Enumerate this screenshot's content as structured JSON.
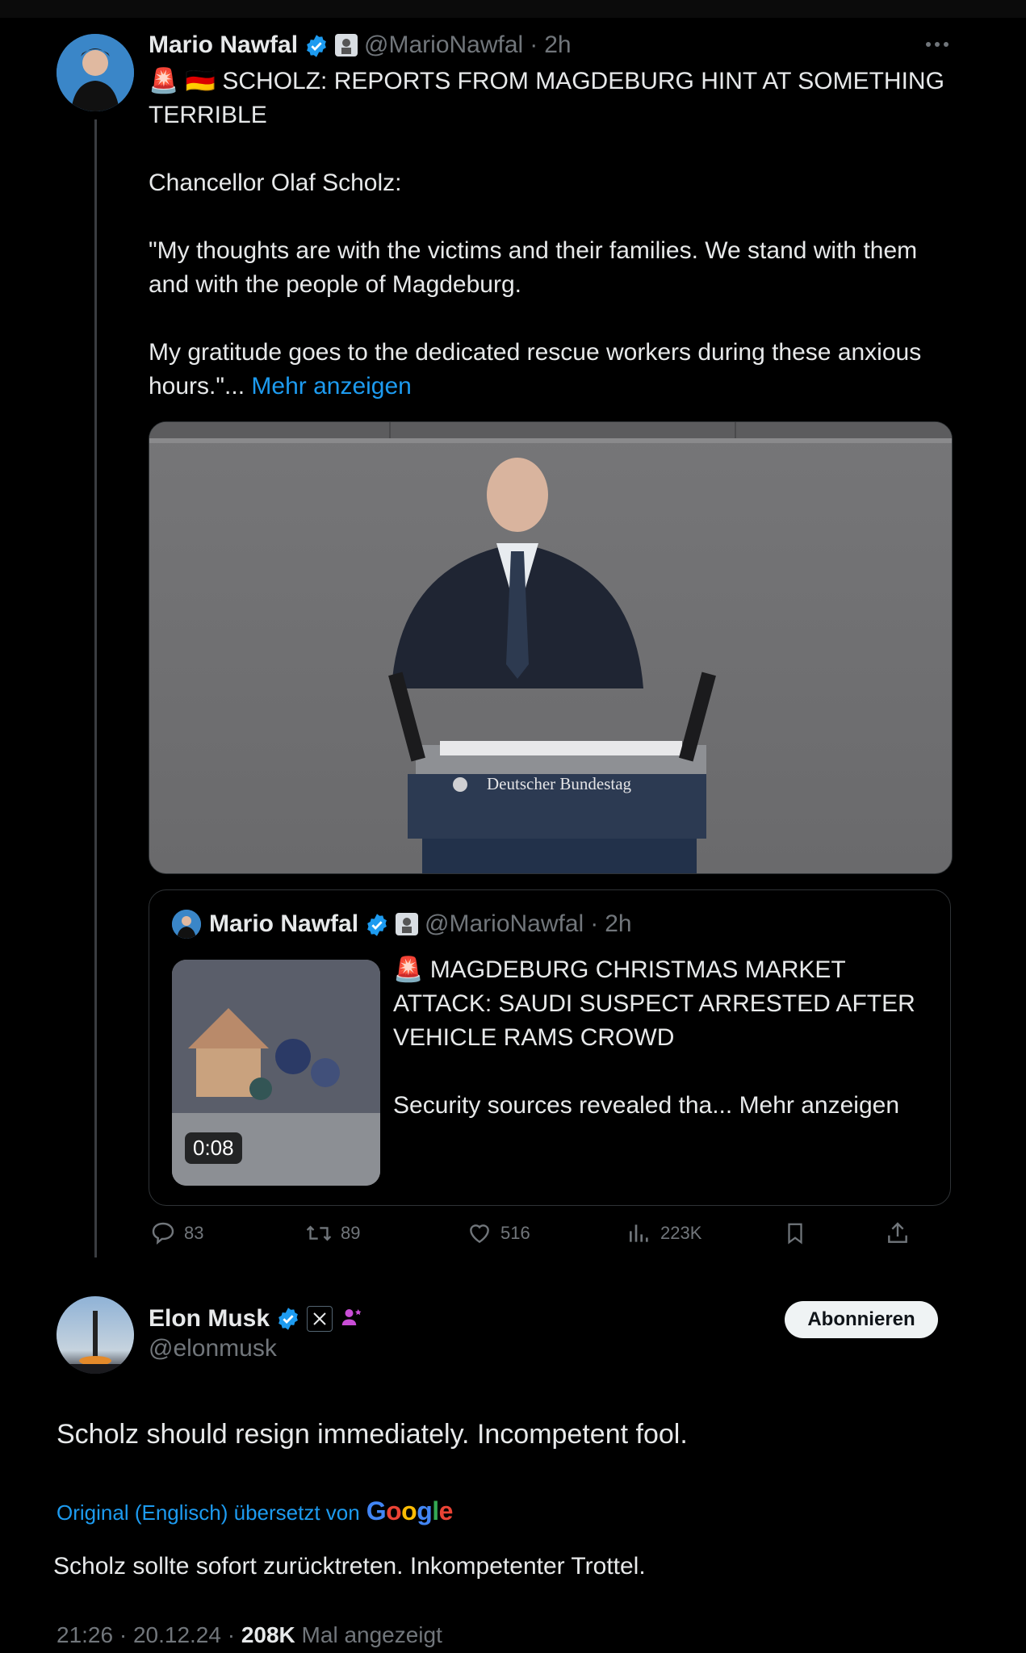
{
  "tweet": {
    "author_name": "Mario Nawfal",
    "handle": "@MarioNawfal",
    "separator": "·",
    "time": "2h",
    "more_icon": "more-horizontal-icon",
    "headline": "🚨 🇩🇪 SCHOLZ: REPORTS FROM MAGDEBURG HINT AT SOMETHING TERRIBLE",
    "para1": "Chancellor Olaf Scholz:",
    "para2": "\"My thoughts are with the victims and their families. We stand with them and with the people of Magdeburg.",
    "para3": "My gratitude goes to the dedicated rescue workers during these anxious hours.\"...",
    "show_more": "Mehr anzeigen",
    "media": {
      "podium_text": "Deutscher Bundestag"
    },
    "quote": {
      "author_name": "Mario Nawfal",
      "handle": "@MarioNawfal",
      "separator": "·",
      "time": "2h",
      "headline": "🚨 MAGDEBURG CHRISTMAS MARKET ATTACK: SAUDI SUSPECT ARRESTED AFTER VEHICLE RAMS CROWD",
      "snippet": "Security sources revealed tha...",
      "show_more": "Mehr anzeigen",
      "video_duration": "0:08"
    },
    "actions": {
      "replies": "83",
      "reposts": "89",
      "likes": "516",
      "views": "223K"
    }
  },
  "reply": {
    "author_name": "Elon Musk",
    "handle": "@elonmusk",
    "subscribe_label": "Abonnieren",
    "text": "Scholz should resign immediately. Incompetent fool.",
    "translation_label": "Original (Englisch) übersetzt von",
    "translation_brand": "Google",
    "translated_text": "Scholz sollte sofort zurücktreten. Inkompetenter Trottel.",
    "timestamp": "21:26 · 20.12.24 ·",
    "views_count": "208K",
    "views_label": "Mal angezeigt"
  },
  "colors": {
    "accent": "#1d9bf0",
    "verified": "#1d9bf0",
    "muted": "#71767b",
    "background": "#000000"
  }
}
